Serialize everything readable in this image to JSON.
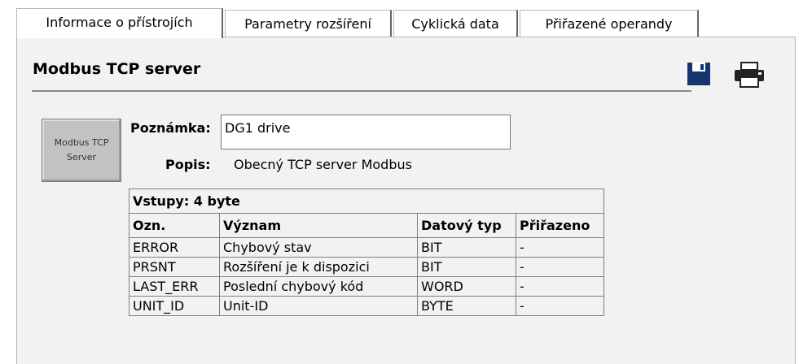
{
  "tabs": [
    {
      "label": "Informace o přístrojích",
      "active": true
    },
    {
      "label": "Parametry rozšíření",
      "active": false
    },
    {
      "label": "Cyklická data",
      "active": false
    },
    {
      "label": "Přiřazené operandy",
      "active": false
    }
  ],
  "header": {
    "title": "Modbus TCP server",
    "save_icon": "save-icon",
    "print_icon": "printer-icon"
  },
  "device": {
    "line1": "Modbus TCP",
    "line2": "Server"
  },
  "fields": {
    "note_label": "Poznámka:",
    "note_value": "DG1 drive",
    "desc_label": "Popis:",
    "desc_value": "Obecný TCP server Modbus"
  },
  "inputs_table": {
    "caption": "Vstupy: 4 byte",
    "columns": [
      "Ozn.",
      "Význam",
      "Datový typ",
      "Přiřazeno"
    ],
    "rows": [
      [
        "ERROR",
        "Chybový stav",
        "BIT",
        "-"
      ],
      [
        "PRSNT",
        "Rozšíření je k dispozici",
        "BIT",
        "-"
      ],
      [
        "LAST_ERR",
        "Poslední chybový kód",
        "WORD",
        "-"
      ],
      [
        "UNIT_ID",
        "Unit-ID",
        "BYTE",
        "-"
      ]
    ]
  }
}
